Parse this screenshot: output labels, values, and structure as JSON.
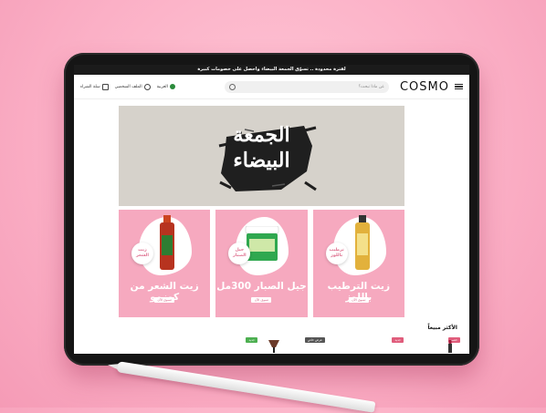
{
  "promo_bar": {
    "text": "لفترة محدودة .. تسوّق الجمعة البيضاء واحصل على خصومات كبيرة"
  },
  "header": {
    "logo": "COSMO",
    "search_placeholder": "عن ماذا تبحث؟",
    "language": "العربية",
    "account": "الملف الشخصي",
    "cart": "سلة الشراء"
  },
  "hero": {
    "line1": "الجمعة",
    "line2": "البيضاء"
  },
  "cards": [
    {
      "title": "زيت الشعر من كوزمو",
      "badge": "زيت الشعر",
      "button": "تسوق الآن"
    },
    {
      "title": "جيل الصبار 300مل",
      "badge": "جيل الصبار",
      "button": "تسوق الآن"
    },
    {
      "title": "زيت الترطيب باللوز",
      "badge": "ترطيب باللوز",
      "button": "تسوق الآن"
    }
  ],
  "bestsellers_title": "الأكثر مبيعاً",
  "product_tags": [
    {
      "label": "خصم",
      "color": "#e05c7b"
    },
    {
      "label": "جديد",
      "color": "#e05c7b"
    },
    {
      "label": "عرض خاص",
      "color": "#555555"
    },
    {
      "label": "جديد",
      "color": "#4caf50"
    }
  ],
  "colors": {
    "accent_pink": "#f6a9bf",
    "background": "#fbb0c6"
  }
}
